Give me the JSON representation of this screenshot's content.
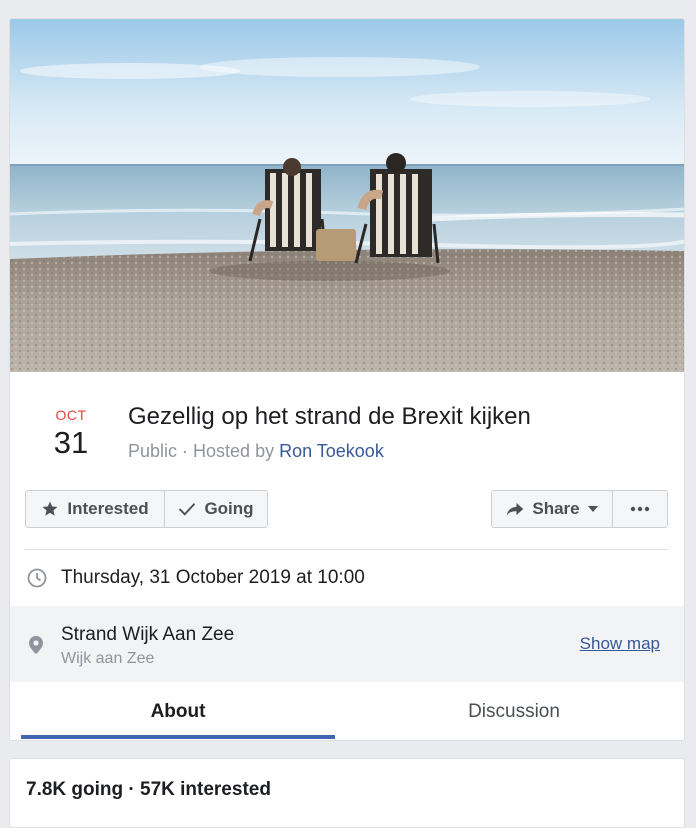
{
  "event": {
    "month": "OCT",
    "day": "31",
    "title": "Gezellig op het strand de Brexit kijken",
    "privacy": "Public",
    "separator": " · ",
    "hosted_by_prefix": "Hosted by ",
    "host": "Ron Toekook",
    "cover_image_icon": "beach-photo"
  },
  "actions": {
    "interested": {
      "label": "Interested",
      "icon": "star-icon"
    },
    "going": {
      "label": "Going",
      "icon": "checkmark-icon"
    },
    "share": {
      "label": "Share",
      "icon": "share-arrow-icon"
    },
    "more": {
      "icon": "ellipsis-icon"
    }
  },
  "details": {
    "datetime": "Thursday, 31 October 2019 at 10:00",
    "location_name": "Strand Wijk Aan Zee",
    "location_city": "Wijk aan Zee",
    "show_map_label": "Show map"
  },
  "tabs": [
    {
      "label": "About",
      "active": true
    },
    {
      "label": "Discussion",
      "active": false
    }
  ],
  "stats": {
    "text": "7.8K going · 57K interested"
  },
  "colors": {
    "accent": "#4267b2",
    "month_red": "#e9433c",
    "link": "#385898",
    "muted": "#90949c",
    "background": "#e9ebee"
  }
}
